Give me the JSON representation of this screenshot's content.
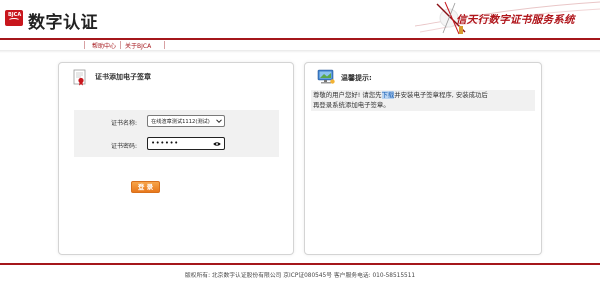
{
  "header": {
    "logo_mark": "BJCA",
    "brand_title": "数字认证",
    "slogan": "信天行数字证书服务系统"
  },
  "nav": {
    "items": [
      {
        "label": "帮助中心"
      },
      {
        "label": "关于BJCA"
      }
    ]
  },
  "left_panel": {
    "title": "证书添加电子签章",
    "cert_name_label": "证书名称:",
    "cert_name_value": "在线渲章测试1112(测试)",
    "cert_password_label": "证书密码:",
    "cert_password_value": "••••••",
    "confirm_label": "登 录"
  },
  "right_panel": {
    "title": "温馨提示:",
    "notice_prefix": "尊敬的用户您好! 请您先",
    "notice_link": "下载",
    "notice_suffix": "并安装电子签章程序, 安装成功后",
    "notice_line2": "再登录系统添加电子签章。"
  },
  "footer": {
    "text": "版权所有: 北京数字认证股份有限公司 京ICP证080545号 客户服务电话: 010-58515511"
  },
  "colors": {
    "brand_red": "#a4161b",
    "button_orange": "#e8781c",
    "link_blue": "#1a5fb4"
  }
}
